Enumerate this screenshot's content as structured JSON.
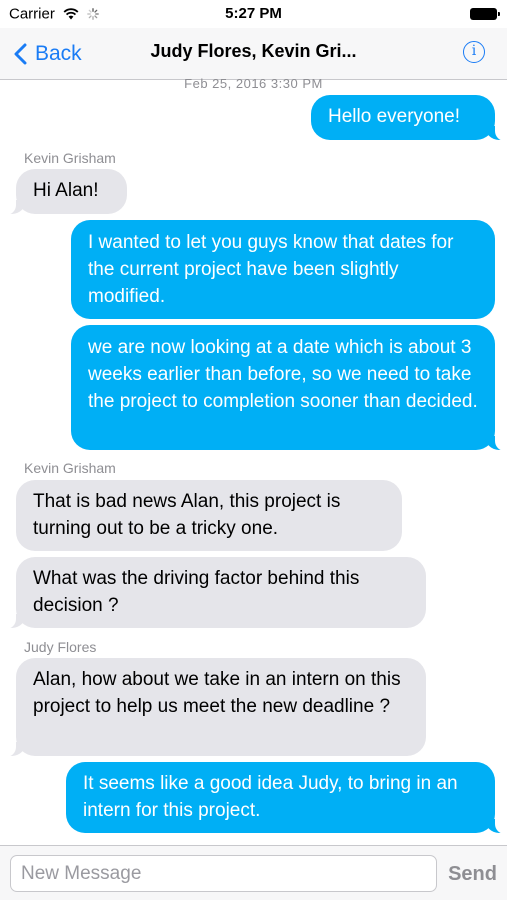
{
  "status": {
    "carrier": "Carrier",
    "time": "5:27 PM"
  },
  "nav": {
    "back_label": "Back",
    "title": "Judy Flores, Kevin Gri...",
    "info_glyph": "i"
  },
  "conversation": {
    "timestamp": "Feb 25, 2016 3:30 PM",
    "messages": [
      {
        "direction": "outgoing",
        "sender": "",
        "text": "Hello everyone!"
      },
      {
        "direction": "incoming",
        "sender": "Kevin Grisham",
        "text": "Hi Alan!"
      },
      {
        "direction": "outgoing",
        "sender": "",
        "text": "I wanted to let you guys know that dates for the current project have been slightly modified."
      },
      {
        "direction": "outgoing",
        "sender": "",
        "text": "we are now looking at a date which is about 3 weeks earlier than before, so we need to take the project to completion sooner than decided."
      },
      {
        "direction": "incoming",
        "sender": "Kevin Grisham",
        "text": "That is bad news Alan, this project is turning out to be a tricky one."
      },
      {
        "direction": "incoming",
        "sender": "",
        "text": "What was the driving factor behind this decision ?"
      },
      {
        "direction": "incoming",
        "sender": "Judy Flores",
        "text": "Alan, how about we take in an intern on this project to help us meet the new deadline ?"
      },
      {
        "direction": "outgoing",
        "sender": "",
        "text": "It seems like a good idea Judy, to bring in an intern for this project."
      }
    ]
  },
  "composer": {
    "placeholder": "New Message",
    "send_label": "Send"
  },
  "colors": {
    "accent": "#1a7cf5",
    "outgoing_bubble": "#00aff5",
    "incoming_bubble": "#e5e5ea"
  },
  "icons": {
    "back": "chevron-left-icon",
    "info": "info-icon",
    "wifi": "wifi-icon",
    "battery": "battery-icon"
  }
}
